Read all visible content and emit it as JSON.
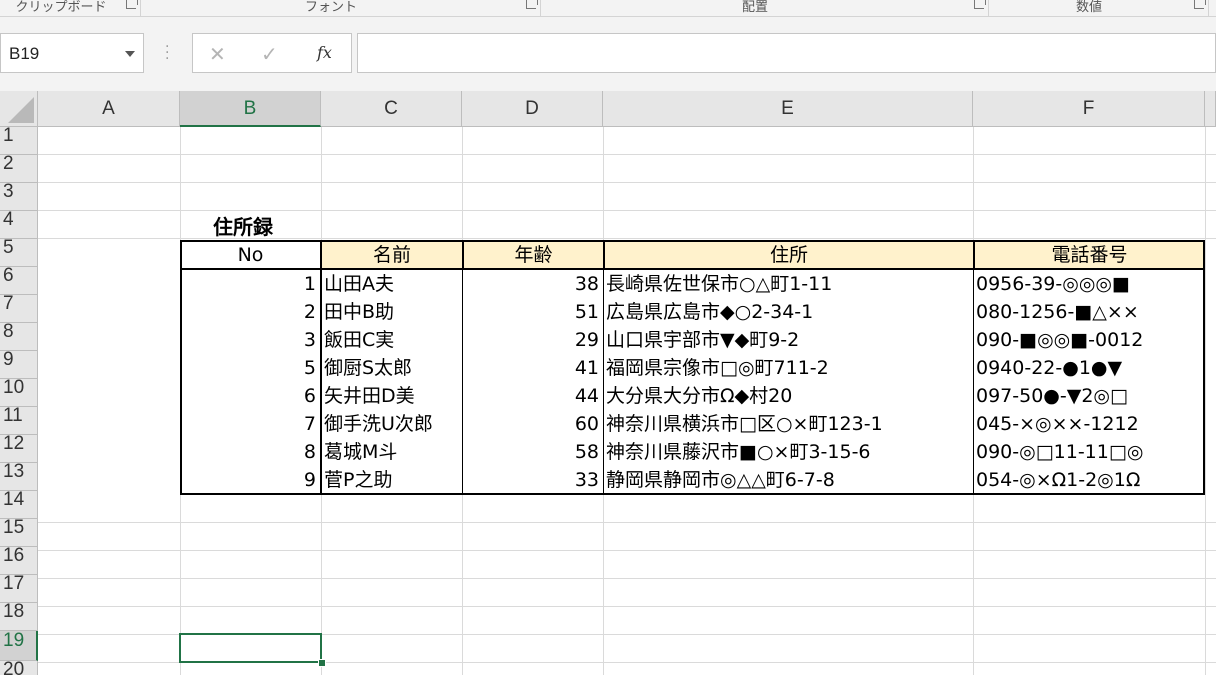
{
  "ribbon": {
    "groups": [
      {
        "label": "クリップボード"
      },
      {
        "label": "フォント"
      },
      {
        "label": "配置"
      },
      {
        "label": "数値"
      }
    ]
  },
  "formula_bar": {
    "name_box": "B19",
    "cancel_glyph": "✕",
    "enter_glyph": "✓",
    "fx_label": "fx",
    "formula": ""
  },
  "sheet": {
    "columns": [
      "A",
      "B",
      "C",
      "D",
      "E",
      "F"
    ],
    "rows": [
      "1",
      "2",
      "3",
      "4",
      "5",
      "6",
      "7",
      "8",
      "9",
      "10",
      "11",
      "12",
      "13",
      "14",
      "15",
      "16",
      "17",
      "18",
      "19",
      "20"
    ],
    "selected_cell": "B19",
    "title": "住所録",
    "table": {
      "headers": [
        "No",
        "名前",
        "年齢",
        "住所",
        "電話番号"
      ],
      "rows": [
        [
          "1",
          "山田A夫",
          "38",
          "長崎県佐世保市○△町1-11",
          "0956-39-◎◎◎■"
        ],
        [
          "2",
          "田中B助",
          "51",
          "広島県広島市◆○2-34-1",
          "080-1256-■△××"
        ],
        [
          "3",
          "飯田C実",
          "29",
          "山口県宇部市▼◆町9-2",
          "090-■◎◎■-0012"
        ],
        [
          "5",
          "御厨S太郎",
          "41",
          "福岡県宗像市□◎町711-2",
          "0940-22-●1●▼"
        ],
        [
          "6",
          "矢井田D美",
          "44",
          "大分県大分市Ω◆村20",
          "097-50●-▼2◎□"
        ],
        [
          "7",
          "御手洗U次郎",
          "60",
          "神奈川県横浜市□区○×町123-1",
          "045-×◎××-1212"
        ],
        [
          "8",
          "葛城M斗",
          "58",
          "神奈川県藤沢市■○×町3-15-6",
          "090-◎□11-11□◎"
        ],
        [
          "9",
          "菅P之助",
          "33",
          "静岡県静岡市◎△△町6-7-8",
          "054-◎×Ω1-2◎1Ω"
        ]
      ]
    }
  },
  "colors": {
    "accent": "#217346",
    "header_fill": "#fff2cc"
  }
}
